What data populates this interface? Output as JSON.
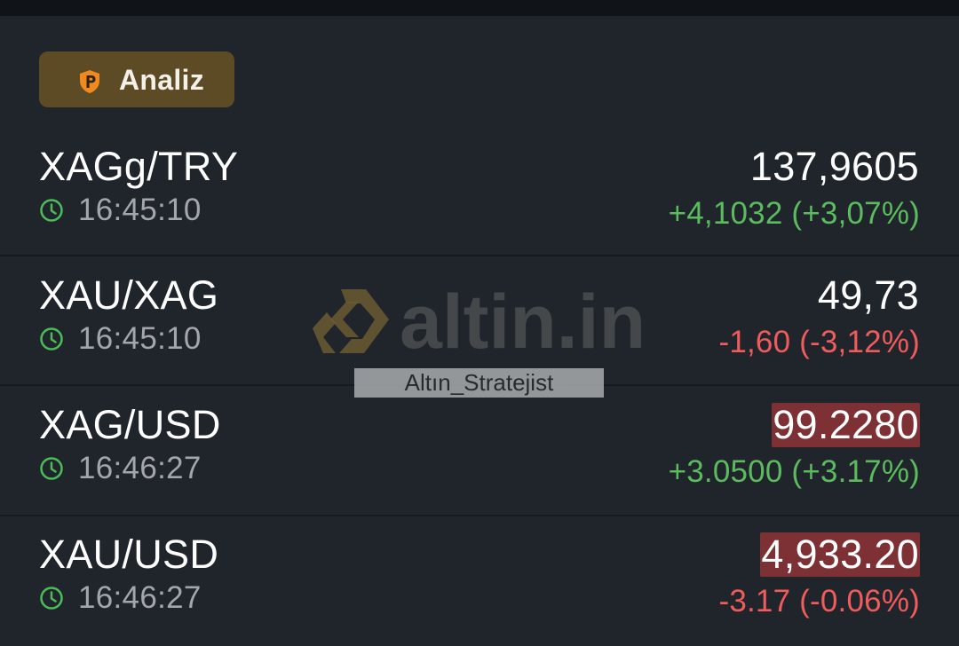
{
  "analiz_button": {
    "label": "Analiz",
    "icon": "shield-p-icon",
    "bg_color": "#5d4b26",
    "icon_color": "#f0891e"
  },
  "quotes": [
    {
      "symbol": "XAGg/TRY",
      "time": "16:45:10",
      "price": "137,9605",
      "change": "+4,1032 (+3,07%)",
      "direction": "positive",
      "highlight": false
    },
    {
      "symbol": "XAU/XAG",
      "time": "16:45:10",
      "price": "49,73",
      "change": "-1,60 (-3,12%)",
      "direction": "negative",
      "highlight": false
    },
    {
      "symbol": "XAG/USD",
      "time": "16:46:27",
      "price": "99.2280",
      "change": "+3.0500 (+3.17%)",
      "direction": "positive",
      "highlight": true
    },
    {
      "symbol": "XAU/USD",
      "time": "16:46:27",
      "price": "4,933.20",
      "change": "-3.17 (-0.06%)",
      "direction": "negative",
      "highlight": true
    }
  ],
  "watermark": {
    "brand": "altin.in",
    "caption": "Altın_Stratejist"
  },
  "colors": {
    "background": "#20252c",
    "positive": "#5bbb5e",
    "negative": "#f05b5b",
    "highlight_bg": "#7d3135",
    "clock": "#4cbc58"
  }
}
